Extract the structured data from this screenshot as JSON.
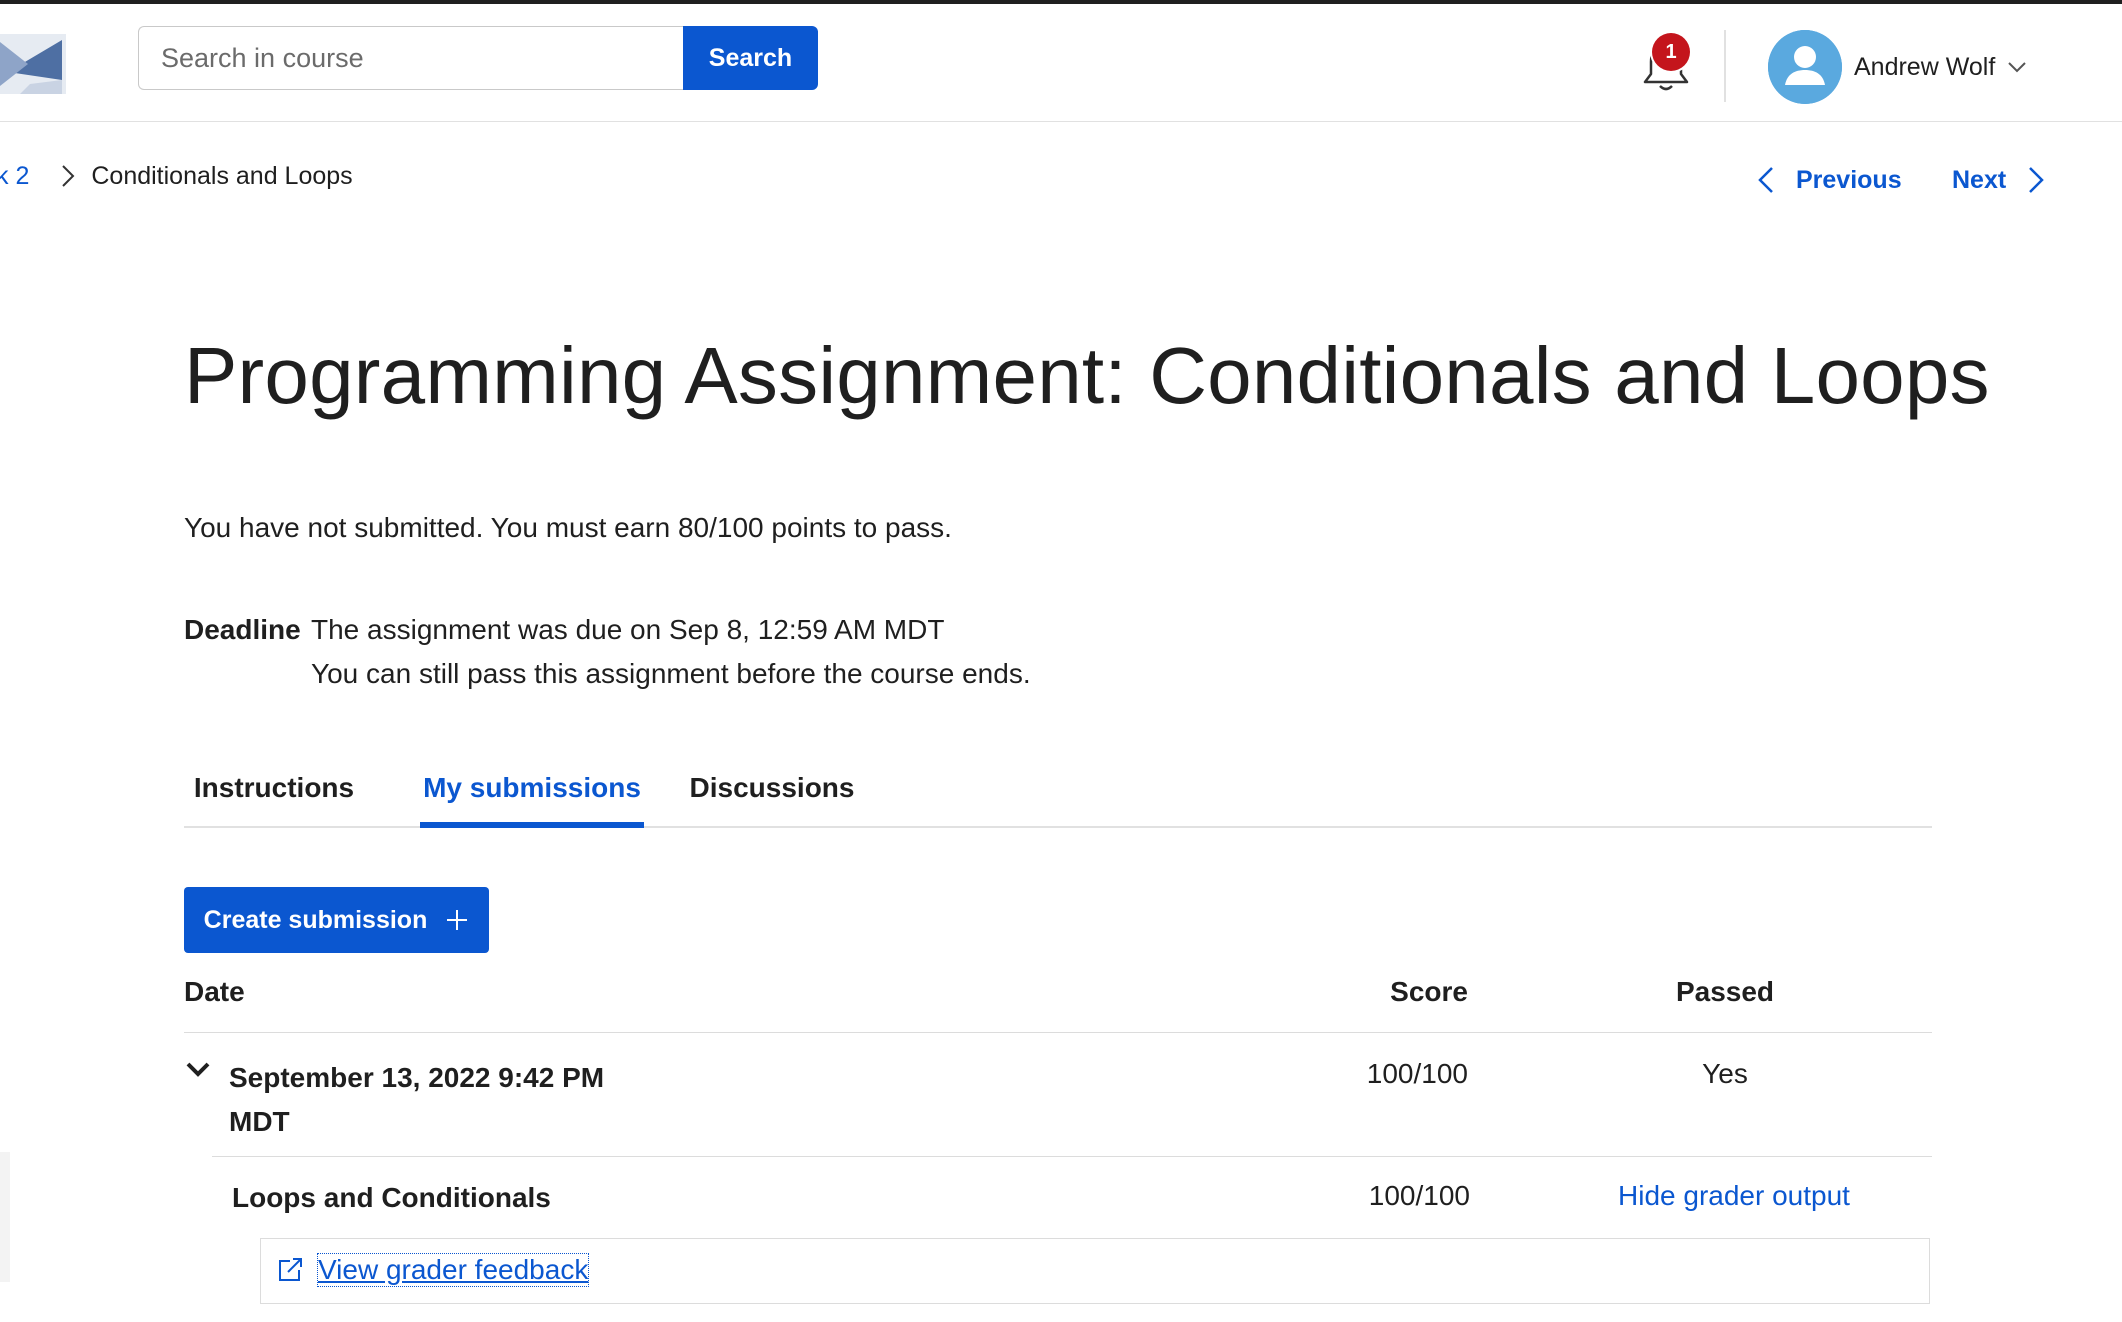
{
  "header": {
    "search": {
      "placeholder": "Search in course",
      "value": "",
      "button_label": "Search"
    },
    "notifications": {
      "count": "1"
    },
    "user": {
      "name": "Andrew Wolf"
    }
  },
  "breadcrumb": {
    "previous": "k 2",
    "current": "Conditionals and Loops"
  },
  "pager": {
    "previous_label": "Previous",
    "next_label": "Next"
  },
  "page": {
    "title": "Programming Assignment: Conditionals and Loops",
    "status": "You have not submitted. You must earn 80/100 points to pass.",
    "deadline_label": "Deadline",
    "deadline_line1": "The assignment was due on Sep 8, 12:59 AM MDT",
    "deadline_line2": "You can still pass this assignment before the course ends."
  },
  "tabs": [
    {
      "label": "Instructions",
      "active": false
    },
    {
      "label": "My submissions",
      "active": true
    },
    {
      "label": "Discussions",
      "active": false
    }
  ],
  "actions": {
    "create_submission": "Create submission"
  },
  "table": {
    "headers": {
      "date": "Date",
      "score": "Score",
      "passed": "Passed"
    },
    "submission": {
      "date_line1": "September 13, 2022 9:42 PM",
      "date_line2": "MDT",
      "score": "100/100",
      "passed": "Yes",
      "parts": [
        {
          "title": "Loops and Conditionals",
          "score": "100/100",
          "action": "Hide grader output",
          "feedback_link": "View grader feedback"
        }
      ]
    }
  },
  "colors": {
    "accent": "#0b57d0",
    "badge": "#c4151c",
    "avatar": "#5aa9df",
    "text": "#1f1f1f",
    "divider": "#e1e1e1"
  }
}
